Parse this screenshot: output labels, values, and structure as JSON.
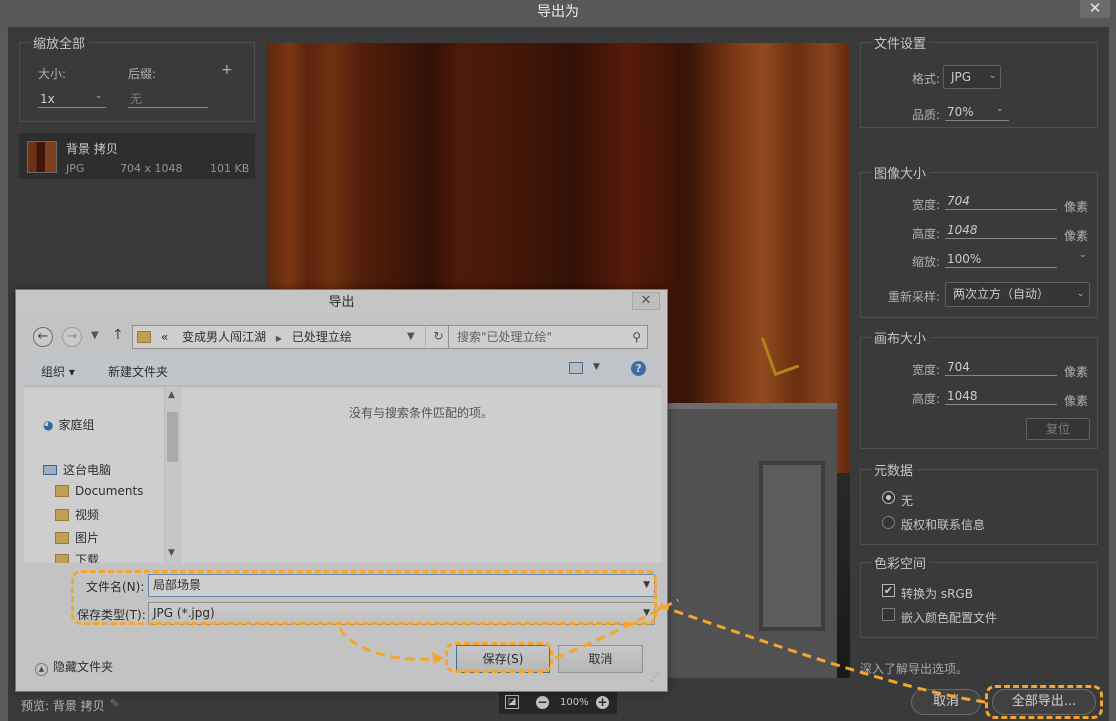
{
  "window": {
    "title": "导出为",
    "close": "✕"
  },
  "left": {
    "scale_title": "缩放全部",
    "size_label": "大小:",
    "suffix_label": "后缀:",
    "add": "+",
    "scale_value": "1x",
    "suffix_placeholder": "无",
    "asset": {
      "name": "背景 拷贝",
      "format": "JPG",
      "dims": "704 x 1048",
      "size": "101 KB"
    }
  },
  "file_settings": {
    "title": "文件设置",
    "format_label": "格式:",
    "format_value": "JPG",
    "quality_label": "品质:",
    "quality_value": "70%"
  },
  "image_size": {
    "title": "图像大小",
    "width_label": "宽度:",
    "width": "704",
    "height_label": "高度:",
    "height": "1048",
    "scale_label": "缩放:",
    "scale": "100%",
    "resample_label": "重新采样:",
    "resample": "两次立方（自动）",
    "unit": "像素"
  },
  "canvas_size": {
    "title": "画布大小",
    "width_label": "宽度:",
    "width": "704",
    "height_label": "高度:",
    "height": "1048",
    "unit": "像素",
    "reset": "复位"
  },
  "metadata": {
    "title": "元数据",
    "opt_none": "无",
    "opt_copyright": "版权和联系信息"
  },
  "color_space": {
    "title": "色彩空间",
    "convert": "转换为 sRGB",
    "embed": "嵌入颜色配置文件"
  },
  "footer": {
    "learn_more": "深入了解导出选项。",
    "preview_label": "预览: 背景 拷贝",
    "zoom": "100%",
    "cancel": "取消",
    "export_all": "全部导出..."
  },
  "dialog": {
    "title": "导出",
    "close": "✕",
    "path": [
      "«",
      "变成男人闯江湖",
      "已处理立绘"
    ],
    "search_placeholder": "搜索\"已处理立绘\"",
    "organize": "组织 ▾",
    "new_folder": "新建文件夹",
    "nav": {
      "homegroup": "家庭组",
      "this_pc": "这台电脑",
      "documents": "Documents",
      "videos": "视频",
      "pictures": "图片",
      "downloads": "下载"
    },
    "empty_message": "没有与搜索条件匹配的项。",
    "filename_label": "文件名(N):",
    "filename": "局部场景",
    "filetype_label": "保存类型(T):",
    "filetype": "JPG (*.jpg)",
    "hide_folders": "隐藏文件夹",
    "save": "保存(S)",
    "cancel": "取消"
  },
  "colors": {
    "highlight": "#f4a52b",
    "panel": "#434343",
    "dialog": "#f0f0f0"
  }
}
